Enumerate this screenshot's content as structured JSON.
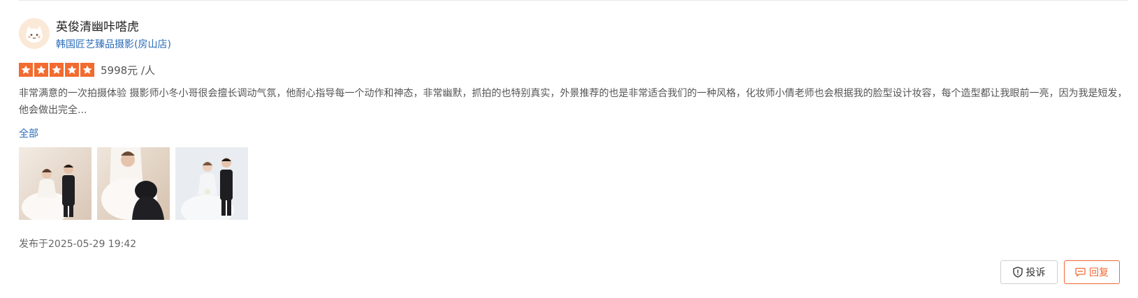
{
  "review": {
    "user_name": "英俊清幽咔嗒虎",
    "shop_name": "韩国匠艺臻品摄影(房山店)",
    "rating_stars": 5,
    "price": "5998元 /人",
    "text": "非常满意的一次拍摄体验 摄影师小冬小哥很会擅长调动气氛，他耐心指导每一个动作和神态，非常幽默，抓拍的也特别真实，外景推荐的也是非常适合我们的一种风格，化妆师小倩老师也会根据我的脸型设计妆容，每个造型都让我眼前一亮，因为我是短发，他会做出完全...",
    "show_all_label": "全部",
    "photos": [
      {
        "icon": "wedding-photo-1"
      },
      {
        "icon": "wedding-photo-2"
      },
      {
        "icon": "wedding-photo-3"
      }
    ],
    "posted_at": "发布于2025-05-29 19:42"
  },
  "actions": {
    "report_label": "投诉",
    "reply_label": "回复"
  },
  "colors": {
    "accent_orange": "#f26b30",
    "link_blue": "#2b6cb8"
  }
}
